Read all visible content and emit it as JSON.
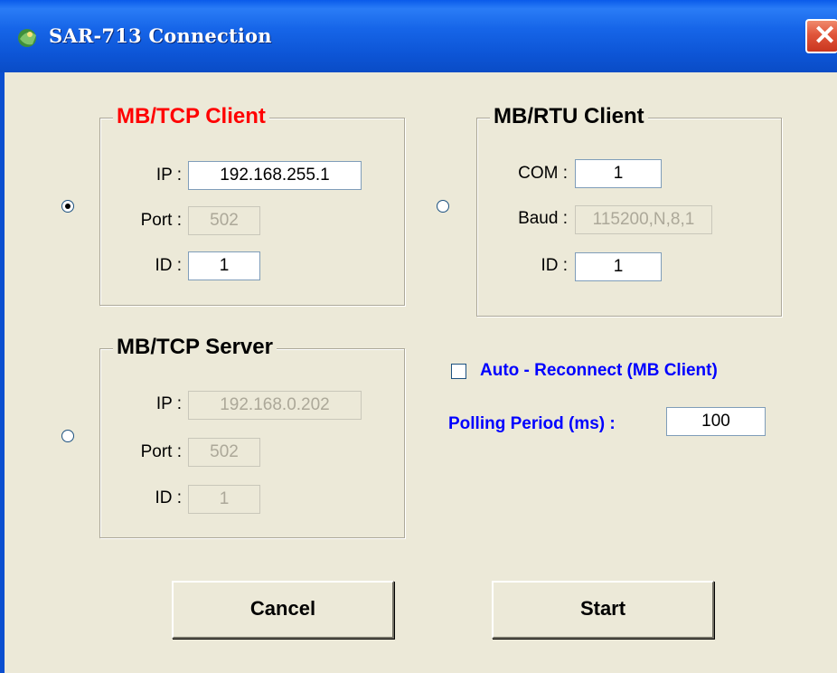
{
  "window": {
    "title": "SAR-713 Connection",
    "close_glyph": "✕"
  },
  "mb_tcp_client": {
    "title": "MB/TCP Client",
    "ip_label": "IP :",
    "ip_value": "192.168.255.1",
    "port_label": "Port :",
    "port_value": "502",
    "id_label": "ID :",
    "id_value": "1",
    "selected": true
  },
  "mb_rtu_client": {
    "title": "MB/RTU Client",
    "com_label": "COM :",
    "com_value": "1",
    "baud_label": "Baud :",
    "baud_value": "115200,N,8,1",
    "id_label": "ID :",
    "id_value": "1",
    "selected": false
  },
  "mb_tcp_server": {
    "title": "MB/TCP Server",
    "ip_label": "IP :",
    "ip_value": "192.168.0.202",
    "port_label": "Port :",
    "port_value": "502",
    "id_label": "ID :",
    "id_value": "1",
    "selected": false
  },
  "options": {
    "auto_reconnect_label": "Auto - Reconnect (MB Client)",
    "auto_reconnect_checked": false,
    "polling_label": "Polling Period (ms) :",
    "polling_value": "100"
  },
  "buttons": {
    "cancel": "Cancel",
    "start": "Start"
  },
  "colors": {
    "titlebar": "#0a5bea",
    "face": "#ece9d8",
    "accent_red": "#ff0000",
    "accent_blue": "#0000ff"
  }
}
